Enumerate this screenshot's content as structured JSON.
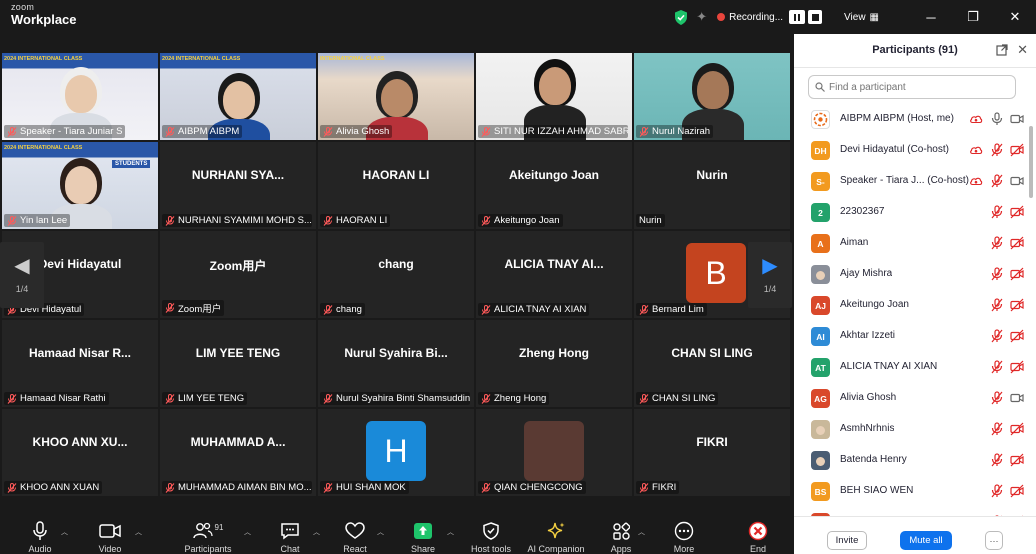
{
  "app": {
    "logo_line1": "zoom",
    "logo_line2": "Workplace"
  },
  "titlebar": {
    "recording_label": "Recording...",
    "view_label": "View"
  },
  "gallery": {
    "page_indicator": "1/4",
    "tiles": [
      {
        "name": "Speaker - Tiara Juniar S",
        "video": true,
        "banner": "2024 INTERNATIONAL CLASS"
      },
      {
        "name": "AIBPM AIBPM",
        "video": true,
        "active": true,
        "banner": "2024 INTERNATIONAL CLASS"
      },
      {
        "name": "Alivia Ghosh",
        "video": true,
        "banner": "INTERNATIONAL CLASS"
      },
      {
        "name": "SITI NUR IZZAH AHMAD SABRI",
        "video": true
      },
      {
        "name": "Nurul Nazirah",
        "video": true
      },
      {
        "name": "Yin lan Lee",
        "video": true,
        "banner": "2024 INTERNATIONAL CLASS",
        "sub_banner": "STUDENTS"
      },
      {
        "center": "NURHANI SYA...",
        "name": "NURHANI SYAMIMI MOHD S..."
      },
      {
        "center": "HAORAN LI",
        "name": "HAORAN LI"
      },
      {
        "center": "Akeitungo Joan",
        "name": "Akeitungo Joan"
      },
      {
        "center": "Nurin",
        "name": "Nurin",
        "mic_hidden": true
      },
      {
        "center": "Devi Hidayatul",
        "name": "Devi Hidayatul"
      },
      {
        "center": "Zoom用户",
        "name": "Zoom用户"
      },
      {
        "center": "chang",
        "name": "chang"
      },
      {
        "center": "ALICIA TNAY AI...",
        "name": "ALICIA TNAY AI XIAN"
      },
      {
        "avatar_letter": "B",
        "name": "Bernard Lim"
      },
      {
        "center": "Hamaad Nisar R...",
        "name": "Hamaad Nisar Rathi"
      },
      {
        "center": "LIM YEE TENG",
        "name": "LIM YEE TENG"
      },
      {
        "center": "Nurul Syahira Bi...",
        "name": "Nurul Syahira Binti Shamsuddin"
      },
      {
        "center": "Zheng Hong",
        "name": "Zheng Hong"
      },
      {
        "center": "CHAN SI LING",
        "name": "CHAN SI LING"
      },
      {
        "center": "KHOO ANN XU...",
        "name": "KHOO ANN XUAN"
      },
      {
        "center": "MUHAMMAD A...",
        "name": "MUHAMMAD AIMAN BIN MO..."
      },
      {
        "avatar_letter": "H",
        "name": "HUI SHAN MOK"
      },
      {
        "avatar_letter": "",
        "name": "QIAN CHENGCONG"
      },
      {
        "center": "FIKRI",
        "name": "FIKRI"
      }
    ]
  },
  "toolbar": {
    "audio": "Audio",
    "video": "Video",
    "participants": "Participants",
    "participants_count": "91",
    "chat": "Chat",
    "react": "React",
    "share": "Share",
    "host_tools": "Host tools",
    "ai_companion": "AI Companion",
    "apps": "Apps",
    "more": "More",
    "end": "End"
  },
  "panel": {
    "title": "Participants (91)",
    "search_placeholder": "Find a participant",
    "invite": "Invite",
    "mute_all": "Mute all",
    "more": "···",
    "participants": [
      {
        "name": "AIBPM AIBPM (Host, me)",
        "avatar": "",
        "color": "#ffffff",
        "mic": "on"
      },
      {
        "name": "Devi Hidayatul (Co-host)",
        "avatar": "DH",
        "color": "#f29a1f",
        "mic": "off"
      },
      {
        "name": "Speaker - Tiara J... (Co-host)",
        "avatar": "S-",
        "color": "#f29a1f",
        "mic": "off"
      },
      {
        "name": "22302367",
        "avatar": "2",
        "color": "#23a26b",
        "mic": "off"
      },
      {
        "name": "Aiman",
        "avatar": "A",
        "color": "#e8701a",
        "mic": "off"
      },
      {
        "name": "Ajay Mishra",
        "avatar": "",
        "color": "#8a8f99",
        "mic": "off"
      },
      {
        "name": "Akeitungo Joan",
        "avatar": "AJ",
        "color": "#d9482b",
        "mic": "off"
      },
      {
        "name": "Akhtar Izzeti",
        "avatar": "AI",
        "color": "#2e8bd6",
        "mic": "off"
      },
      {
        "name": "ALICIA TNAY AI XIAN",
        "avatar": "AT",
        "color": "#23a26b",
        "mic": "off"
      },
      {
        "name": "Alivia Ghosh",
        "avatar": "AG",
        "color": "#d9482b",
        "mic": "off"
      },
      {
        "name": "AsmhNrhnis",
        "avatar": "",
        "color": "#c9b89a",
        "mic": "off"
      },
      {
        "name": "Batenda Henry",
        "avatar": "",
        "color": "#4a5d73",
        "mic": "off"
      },
      {
        "name": "BEH SIAO WEN",
        "avatar": "BS",
        "color": "#f29a1f",
        "mic": "off"
      },
      {
        "name": "",
        "avatar": "B",
        "color": "#d9482b",
        "mic": "off"
      }
    ]
  }
}
